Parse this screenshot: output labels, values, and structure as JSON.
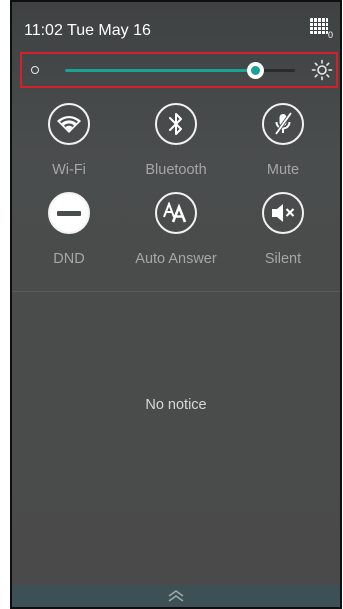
{
  "status_bar": {
    "time": "11:02 Tue May 16",
    "icon": "grid-keypad-icon",
    "count": "0"
  },
  "brightness": {
    "level": 0.83,
    "min_icon": "brightness-low-icon",
    "max_icon": "brightness-high-icon",
    "accent": "#18a394",
    "highlight_color": "#d4202a"
  },
  "toggles": [
    {
      "label": "Wi-Fi",
      "icon": "wifi-icon"
    },
    {
      "label": "Bluetooth",
      "icon": "bluetooth-icon"
    },
    {
      "label": "Mute",
      "icon": "mic-mute-icon"
    },
    {
      "label": "DND",
      "icon": "do-not-disturb-icon"
    },
    {
      "label": "Auto Answer",
      "icon": "auto-answer-icon"
    },
    {
      "label": "Silent",
      "icon": "speaker-mute-icon"
    }
  ],
  "notifications": {
    "empty_text": "No notice"
  },
  "handle": {
    "icon": "chevron-double-up-icon"
  }
}
